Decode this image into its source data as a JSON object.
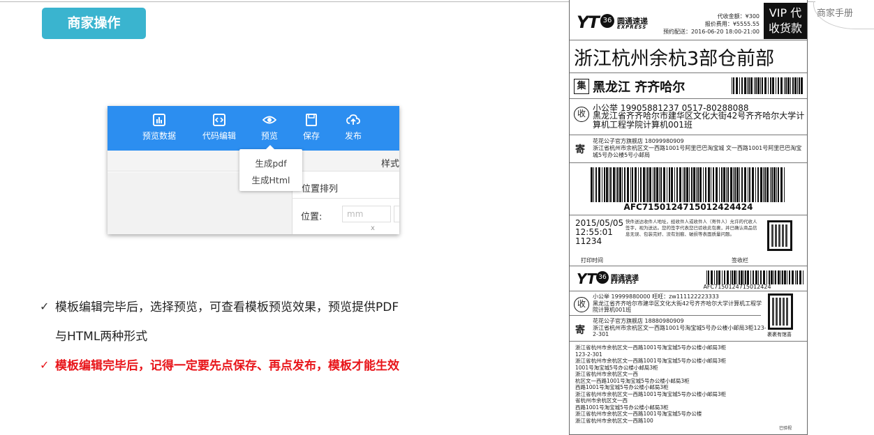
{
  "header": {
    "badge_label": "商家操作",
    "manual_label": "商家手册"
  },
  "editor": {
    "toolbar": [
      {
        "label": "预览数据",
        "icon": "chart-icon"
      },
      {
        "label": "代码编辑",
        "icon": "code-icon"
      },
      {
        "label": "预览",
        "icon": "eye-icon"
      },
      {
        "label": "保存",
        "icon": "save-icon"
      },
      {
        "label": "发布",
        "icon": "cloud-upload-icon"
      }
    ],
    "style_tab": "样式",
    "dropdown_items": [
      "生成pdf",
      "生成Html"
    ],
    "section_title": "位置排列",
    "position_label": "位置:",
    "position_placeholder": "mm",
    "x_label": "x"
  },
  "bullets": [
    {
      "text": "模板编辑完毕后，选择预览，可查看模板预览效果，预览提供PDF",
      "cont": "与HTML两种形式"
    },
    {
      "text": "模板编辑完毕后，记得一定要先点保存、再点发布，模板才能生效"
    }
  ],
  "waybill": {
    "logo": "YT",
    "logo_circle": "36",
    "brand_cn": "圆通速递",
    "brand_en": "EXPRESS",
    "cod": "代收金额：¥300",
    "insured": "报价费用：¥5555.55",
    "appointment": "预约配送：2016-06-20 18:00-21:00",
    "vip_line1": "VIP 代",
    "vip_line2": "收货款",
    "destination": "浙江杭州余杭3部仓前部",
    "ji": "集",
    "region": "黑龙江 齐齐哈尔",
    "shou": "收",
    "recipient": "小公举   19905881237   0517-80288088",
    "recipient_addr": "黑龙江省齐齐哈尔市建华区文化大街42号齐齐哈尔大学计算机工程学院计算机001班",
    "ji_sender": "寄",
    "sender": "花花公子官方旗舰店   18099980909",
    "sender_addr": "浙江省杭州市余杭区文一西路1001号阿里巴巴淘宝城 文一西路1001号阿里巴巴淘宝城5号办公楼5号小邮局",
    "tracking": "AFC7150124715012424424",
    "date": "2015/05/05",
    "time": "12:55:01",
    "code": "11234",
    "notice": "快件送达收件人地址，经收件人或收件人（寄件人）允许的代收人签字，视为送达。您的签字代表您已验收此包裹，并已确认商品信息无误、包装完好、没有划痕、破损等表面质量问题。",
    "print_time": "打印时间",
    "sign_label": "签收栏",
    "tracking2": "AFC7150124715012424",
    "recv2_line": "小公举   19999880000   旺旺：zw111122223333",
    "recv2_addr": "黑龙江省齐齐哈尔市建华区文化大街42号齐齐哈尔大学计算机工程学院计算机001班",
    "send2_line": "花花公子官方旗舰店   18880980909",
    "send2_addr": "浙江省杭州市余杭区文一西路1001号淘宝城5号办公楼小邮局3柜123-2-301",
    "signed_label": "裹裹有馆喜",
    "addr_list": [
      "浙江省杭州市余杭区文一西路1001号淘宝城5号办公楼小邮局3柜",
      "123-2-301",
      "浙江省杭州市余杭区文一西路1001号淘宝城5号办公楼小邮局3柜",
      "1001号淘宝城5号办公楼小邮局3柜",
      "浙江省杭州市余杭区文一西",
      "杭区文一西路1001号淘宝城5号办公楼小邮局3柜",
      "西路1001号淘宝城5号办公楼小邮局3柜",
      "浙江省杭州市余杭区文一西路1001号淘宝城5号办公楼小邮局3柜",
      "省杭州市余杭区文一西",
      "西路1001号淘宝城5号办公楼小邮局3柜",
      "浙江省杭州市余杭区文一西路1001号淘宝城5号办公楼",
      "浙江省杭州市余杭区文一西路100"
    ],
    "footer_signed": "已验视"
  }
}
